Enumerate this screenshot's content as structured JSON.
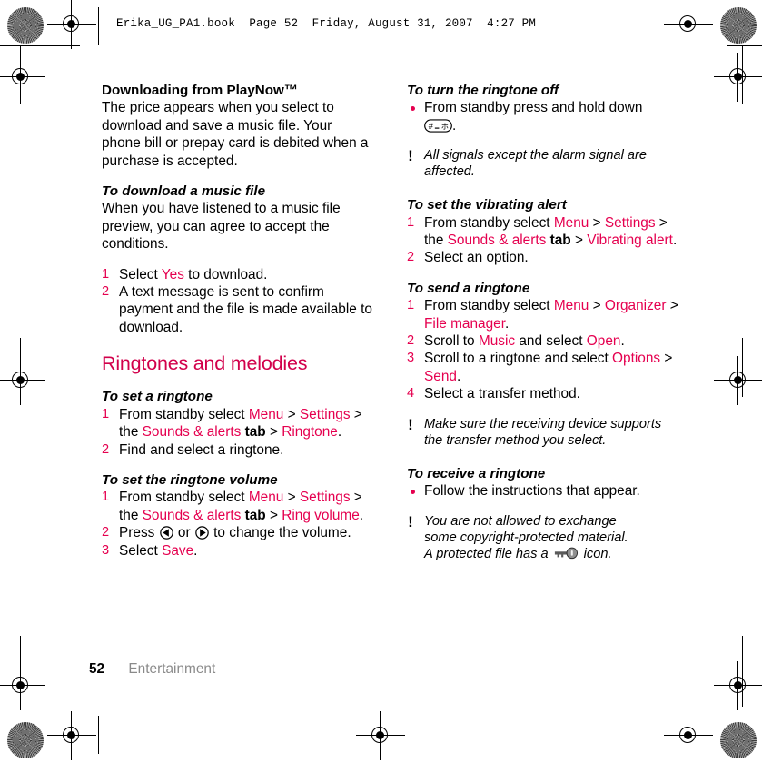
{
  "document": {
    "slug_line": "Erika_UG_PA1.book  Page 52  Friday, August 31, 2007  4:27 PM",
    "footer": {
      "page_number": "52",
      "chapter": "Entertainment"
    },
    "accent_color": "#e5004f",
    "heading_color": "#d2004b"
  },
  "left_column": {
    "playnow": {
      "heading": "Downloading from PlayNow™",
      "body": "The price appears when you select to download and save a music file. Your phone bill or prepay card is debited when a purchase is accepted."
    },
    "download_music": {
      "heading": "To download a music file",
      "body": "When you have listened to a music file preview, you can agree to accept the conditions.",
      "steps": [
        {
          "parts": [
            {
              "t": "Select ",
              "s": "plain"
            },
            {
              "t": "Yes",
              "s": "ui"
            },
            {
              "t": " to download.",
              "s": "plain"
            }
          ]
        },
        {
          "parts": [
            {
              "t": "A text message is sent to confirm payment and the file is made available to download.",
              "s": "plain"
            }
          ]
        }
      ]
    },
    "section_heading": "Ringtones and melodies",
    "set_ringtone": {
      "heading": "To set a ringtone",
      "steps": [
        {
          "parts": [
            {
              "t": "From standby select ",
              "s": "plain"
            },
            {
              "t": "Menu",
              "s": "ui"
            },
            {
              "t": " > ",
              "s": "plain"
            },
            {
              "t": "Settings",
              "s": "ui"
            },
            {
              "t": " > the ",
              "s": "plain"
            },
            {
              "t": "Sounds & alerts",
              "s": "ui"
            },
            {
              "t": " tab",
              "s": "bold"
            },
            {
              "t": " > ",
              "s": "plain"
            },
            {
              "t": "Ringtone",
              "s": "ui"
            },
            {
              "t": ".",
              "s": "plain"
            }
          ]
        },
        {
          "parts": [
            {
              "t": "Find and select a ringtone.",
              "s": "plain"
            }
          ]
        }
      ]
    },
    "ringtone_volume": {
      "heading": "To set the ringtone volume",
      "steps": [
        {
          "parts": [
            {
              "t": "From standby select ",
              "s": "plain"
            },
            {
              "t": "Menu",
              "s": "ui"
            },
            {
              "t": " > ",
              "s": "plain"
            },
            {
              "t": "Settings",
              "s": "ui"
            },
            {
              "t": " > the ",
              "s": "plain"
            },
            {
              "t": "Sounds & alerts",
              "s": "ui"
            },
            {
              "t": " tab",
              "s": "bold"
            },
            {
              "t": " > ",
              "s": "plain"
            },
            {
              "t": "Ring volume",
              "s": "ui"
            },
            {
              "t": ".",
              "s": "plain"
            }
          ]
        },
        {
          "parts": [
            {
              "t": "Press ",
              "s": "plain"
            },
            {
              "t": "nav-left-key-icon",
              "s": "icon"
            },
            {
              "t": " or ",
              "s": "plain"
            },
            {
              "t": "nav-right-key-icon",
              "s": "icon"
            },
            {
              "t": " to change the volume.",
              "s": "plain"
            }
          ]
        },
        {
          "parts": [
            {
              "t": "Select ",
              "s": "plain"
            },
            {
              "t": "Save",
              "s": "ui"
            },
            {
              "t": ".",
              "s": "plain"
            }
          ]
        }
      ]
    }
  },
  "right_column": {
    "ringtone_off": {
      "heading": "To turn the ringtone off",
      "bullet_text_before": "From standby press and hold down ",
      "bullet_icon": "hash-key-icon",
      "bullet_text_after": ".",
      "note": "All signals except the alarm signal are affected."
    },
    "vibrating_alert": {
      "heading": "To set the vibrating alert",
      "steps": [
        {
          "parts": [
            {
              "t": "From standby select ",
              "s": "plain"
            },
            {
              "t": "Menu",
              "s": "ui"
            },
            {
              "t": " > ",
              "s": "plain"
            },
            {
              "t": "Settings",
              "s": "ui"
            },
            {
              "t": " > the ",
              "s": "plain"
            },
            {
              "t": "Sounds & alerts",
              "s": "ui"
            },
            {
              "t": " tab",
              "s": "bold"
            },
            {
              "t": " > ",
              "s": "plain"
            },
            {
              "t": "Vibrating alert",
              "s": "ui"
            },
            {
              "t": ".",
              "s": "plain"
            }
          ]
        },
        {
          "parts": [
            {
              "t": "Select an option.",
              "s": "plain"
            }
          ]
        }
      ]
    },
    "send_ringtone": {
      "heading": "To send a ringtone",
      "steps": [
        {
          "parts": [
            {
              "t": "From standby select ",
              "s": "plain"
            },
            {
              "t": "Menu",
              "s": "ui"
            },
            {
              "t": " > ",
              "s": "plain"
            },
            {
              "t": "Organizer",
              "s": "ui"
            },
            {
              "t": " > ",
              "s": "plain"
            },
            {
              "t": "File manager",
              "s": "ui"
            },
            {
              "t": ".",
              "s": "plain"
            }
          ]
        },
        {
          "parts": [
            {
              "t": "Scroll to ",
              "s": "plain"
            },
            {
              "t": "Music",
              "s": "ui"
            },
            {
              "t": " and select ",
              "s": "plain"
            },
            {
              "t": "Open",
              "s": "ui"
            },
            {
              "t": ".",
              "s": "plain"
            }
          ]
        },
        {
          "parts": [
            {
              "t": "Scroll to a ringtone and select ",
              "s": "plain"
            },
            {
              "t": "Options",
              "s": "ui"
            },
            {
              "t": " > ",
              "s": "plain"
            },
            {
              "t": "Send",
              "s": "ui"
            },
            {
              "t": ".",
              "s": "plain"
            }
          ]
        },
        {
          "parts": [
            {
              "t": "Select a transfer method.",
              "s": "plain"
            }
          ]
        }
      ],
      "note": "Make sure the receiving device supports the transfer method you select."
    },
    "receive_ringtone": {
      "heading": "To receive a ringtone",
      "bullet": "Follow the instructions that appear.",
      "note_line1": "You are not allowed to exchange",
      "note_line2": "some copyright-protected material.",
      "note_line3_before": "A protected file has a ",
      "note_icon": "key-icon",
      "note_line3_after": " icon."
    }
  }
}
